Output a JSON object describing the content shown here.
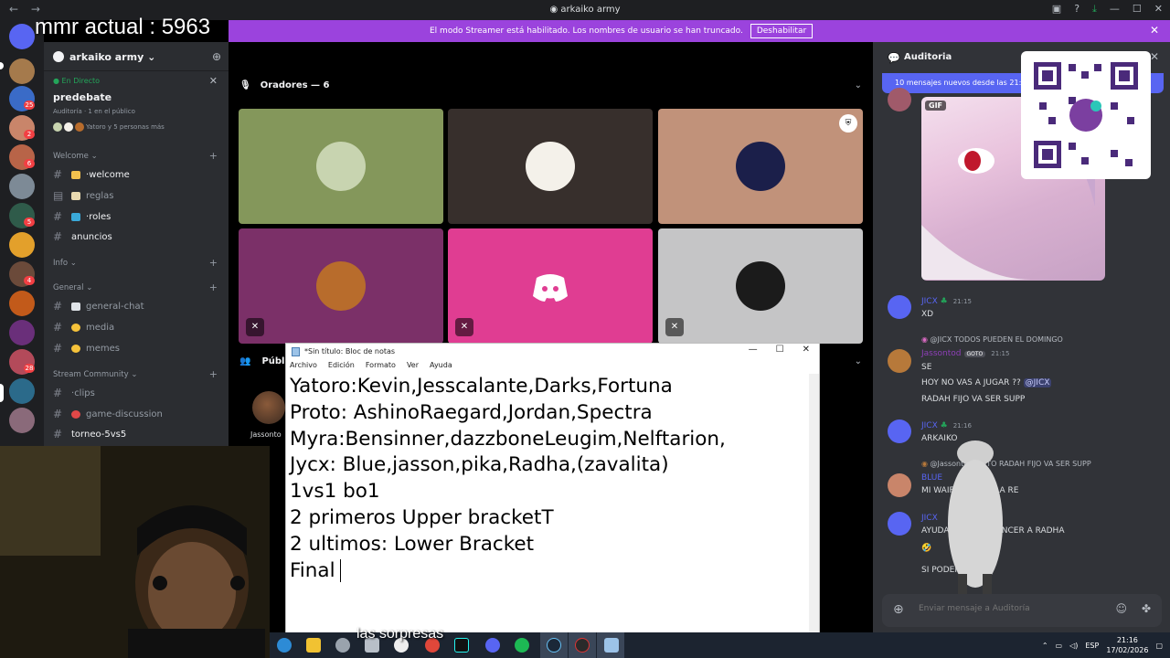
{
  "window": {
    "title": "arkaiko army",
    "nav_back": "←",
    "nav_forward": "→"
  },
  "overlay": {
    "mmr": "mmr actual : 5963",
    "subtitle": "las sorpresas"
  },
  "banner": {
    "text": "El modo Streamer está habilitado. Los nombres de usuario se han truncado.",
    "button": "Deshabilitar",
    "close": "✕"
  },
  "rail": {
    "badges": [
      "25",
      "2",
      "6",
      "5",
      "4",
      "28"
    ]
  },
  "sidebar": {
    "server_name": "arkaiko army",
    "live_label": "En Directo",
    "stage_name": "predebate",
    "stage_meta": "Auditoría · 1 en el público",
    "stage_people": "Yatoro y 5 personas más",
    "categories": {
      "welcome": "Welcome",
      "info": "Info",
      "general": "General",
      "stream": "Stream Community"
    },
    "channels": {
      "welcome": "welcome",
      "reglas": "reglas",
      "roles": "roles",
      "anuncios": "anuncios",
      "general_chat": "general-chat",
      "media": "media",
      "memes": "memes",
      "clips": "clips",
      "game_discussion": "game-discussion",
      "torneo": "torneo-5vs5"
    }
  },
  "stage": {
    "speakers_label": "Oradores — 6",
    "public_label": "Público",
    "public_user": "Jassonto",
    "tiles": [
      {
        "bg": "#84975b",
        "avatar": "#c8d4b0"
      },
      {
        "bg": "#372f2c",
        "avatar": "#f4f1ea"
      },
      {
        "bg": "#c1927a",
        "avatar": "#1b1f4a"
      },
      {
        "bg": "#7b3068",
        "avatar": "#b86c2c"
      },
      {
        "bg": "#e03d92",
        "avatar": "#ffffff"
      },
      {
        "bg": "#c5c5c6",
        "avatar": "#1b1b1b"
      }
    ]
  },
  "chat": {
    "title": "Auditoria",
    "new_messages": "10 mensajes nuevos desde las 21:15",
    "gif_label": "GIF",
    "messages": [
      {
        "user": "JICX",
        "time": "21:15",
        "text": "XD"
      },
      {
        "reply": "@JICX TODOS PUEDEN EL DOMINGO",
        "user": "Jassontod",
        "tag": "GOTO",
        "time": "21:15",
        "lines": [
          "SE",
          "HOY NO VAS A JUGAR ??",
          "RADAH FIJO VA SER SUPP"
        ],
        "mention": "@JICX"
      },
      {
        "user": "JICX",
        "time": "21:16",
        "text": "ARKAIKO"
      },
      {
        "reply": "@Jassontod GOTO RADAH FIJO VA SER SUPP",
        "user": "BLUE",
        "text": "MI WAIFU VA SER LA RE"
      },
      {
        "user": "JICX",
        "lines": [
          "AYUDAME A CONVENCER A RADHA",
          "🤣",
          "SI PODEMOS"
        ]
      }
    ],
    "composer_placeholder": "Enviar mensaje a Auditoría"
  },
  "notepad": {
    "title": "*Sin título: Bloc de notas",
    "menu": [
      "Archivo",
      "Edición",
      "Formato",
      "Ver",
      "Ayuda"
    ],
    "lines": [
      "Yatoro:Kevin,Jesscalante,Darks,Fortuna",
      "Proto: AshinoRaegard,Jordan,Spectra",
      "Myra:Bensinner,dazzboneLeugim,Nelftarion,",
      "Jycx: Blue,jasson,pika,Radha,(zavalita)",
      "1vs1 bo1",
      "2 primeros Upper bracketT",
      "2 ultimos: Lower Bracket",
      "Final"
    ]
  },
  "taskbar": {
    "lang": "ESP",
    "time": "21:16",
    "date": "17/02/2026"
  }
}
